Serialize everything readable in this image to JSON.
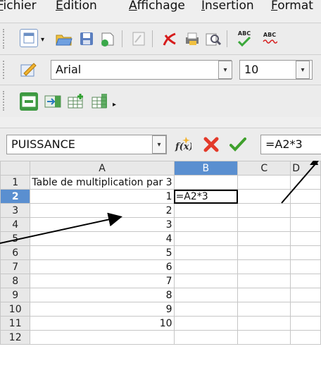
{
  "menu": {
    "items": [
      {
        "pre": "",
        "accel": "F",
        "post": "ichier"
      },
      {
        "pre": "",
        "accel": "E",
        "post": "dition"
      },
      {
        "pre": "",
        "accel": "A",
        "post": "ffichage"
      },
      {
        "pre": "",
        "accel": "I",
        "post": "nsertion"
      },
      {
        "pre": "",
        "accel": "F",
        "post": "ormat"
      }
    ]
  },
  "toolbar": {
    "icons": [
      "new-document-icon",
      "open-folder-icon",
      "save-icon",
      "edit-document-icon",
      "edit-file-icon",
      "export-pdf-icon",
      "print-icon",
      "page-preview-icon",
      "spellcheck-icon",
      "autocheck-icon"
    ],
    "spell_label": "ABC",
    "autospell_label": "ABC"
  },
  "format_bar": {
    "font_name": "Arial",
    "font_size": "10"
  },
  "formula_bar": {
    "name_box": "PUISSANCE",
    "formula": "=A2*3"
  },
  "sheet": {
    "columns": [
      "A",
      "B",
      "C",
      "D"
    ],
    "selected_column": "B",
    "selected_row": "2",
    "rows": [
      {
        "header": "1",
        "A": "Table de multiplication par 3",
        "B": ""
      },
      {
        "header": "2",
        "A": "1",
        "B": "=A2*3"
      },
      {
        "header": "3",
        "A": "2",
        "B": ""
      },
      {
        "header": "4",
        "A": "3",
        "B": ""
      },
      {
        "header": "5",
        "A": "4",
        "B": ""
      },
      {
        "header": "6",
        "A": "5",
        "B": ""
      },
      {
        "header": "7",
        "A": "6",
        "B": ""
      },
      {
        "header": "8",
        "A": "7",
        "B": ""
      },
      {
        "header": "9",
        "A": "8",
        "B": ""
      },
      {
        "header": "10",
        "A": "9",
        "B": ""
      },
      {
        "header": "11",
        "A": "10",
        "B": ""
      },
      {
        "header": "12",
        "A": "",
        "B": ""
      }
    ]
  },
  "colors": {
    "selection_header": "#5a8fd0",
    "cancel_red": "#e33a2a",
    "accept_green": "#3fa02c"
  }
}
